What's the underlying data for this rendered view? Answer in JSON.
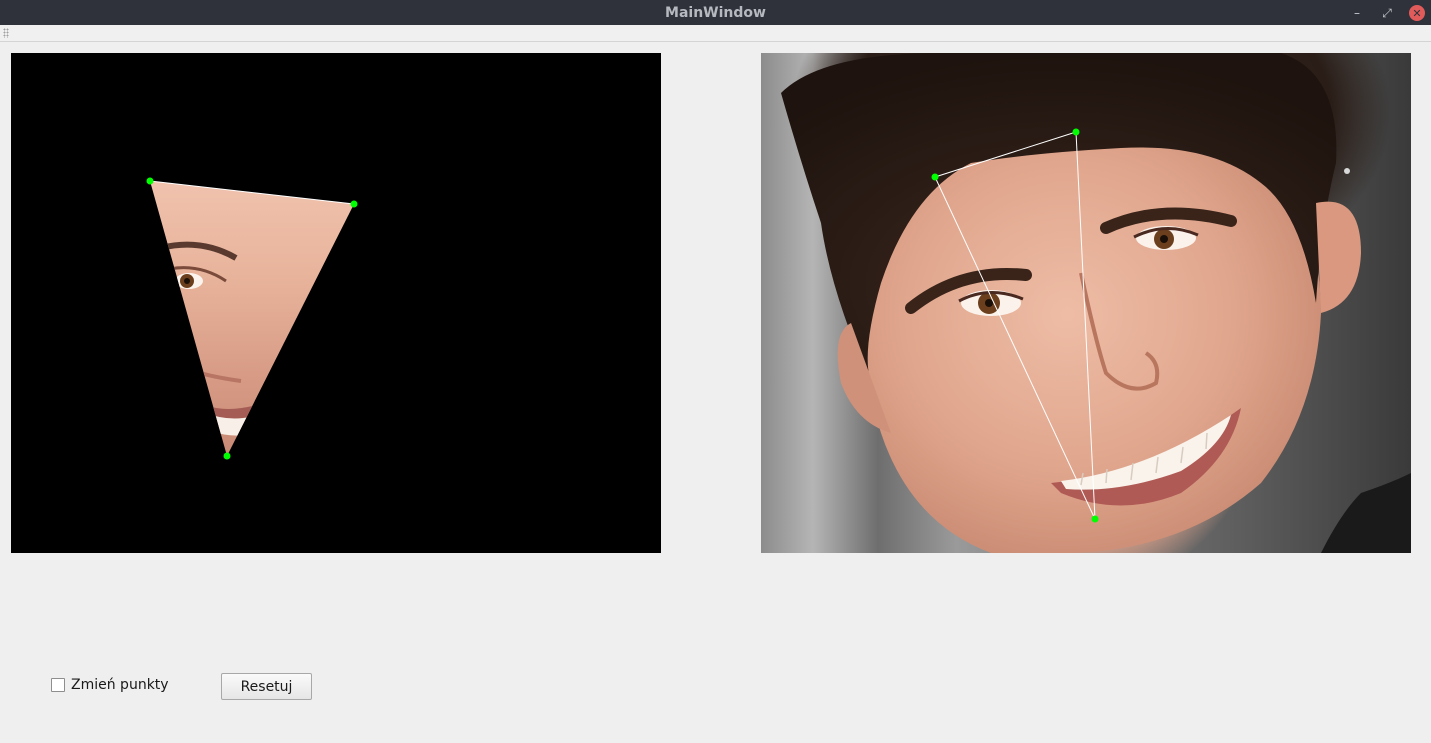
{
  "window": {
    "title": "MainWindow",
    "minimize_glyph": "–",
    "maximize_glyph": "⤢",
    "close_glyph": "✕"
  },
  "images": {
    "left": {
      "description_icon": "warped-triangle-image"
    },
    "right": {
      "description_icon": "source-face-image"
    }
  },
  "controls": {
    "checkbox_label": "Zmień punkty",
    "checkbox_checked": false,
    "reset_label": "Resetuj"
  },
  "colors": {
    "marker": "#00ff00",
    "triangle_line": "#ffffff",
    "titlebar": "#2f323a",
    "close": "#e25b5b"
  }
}
